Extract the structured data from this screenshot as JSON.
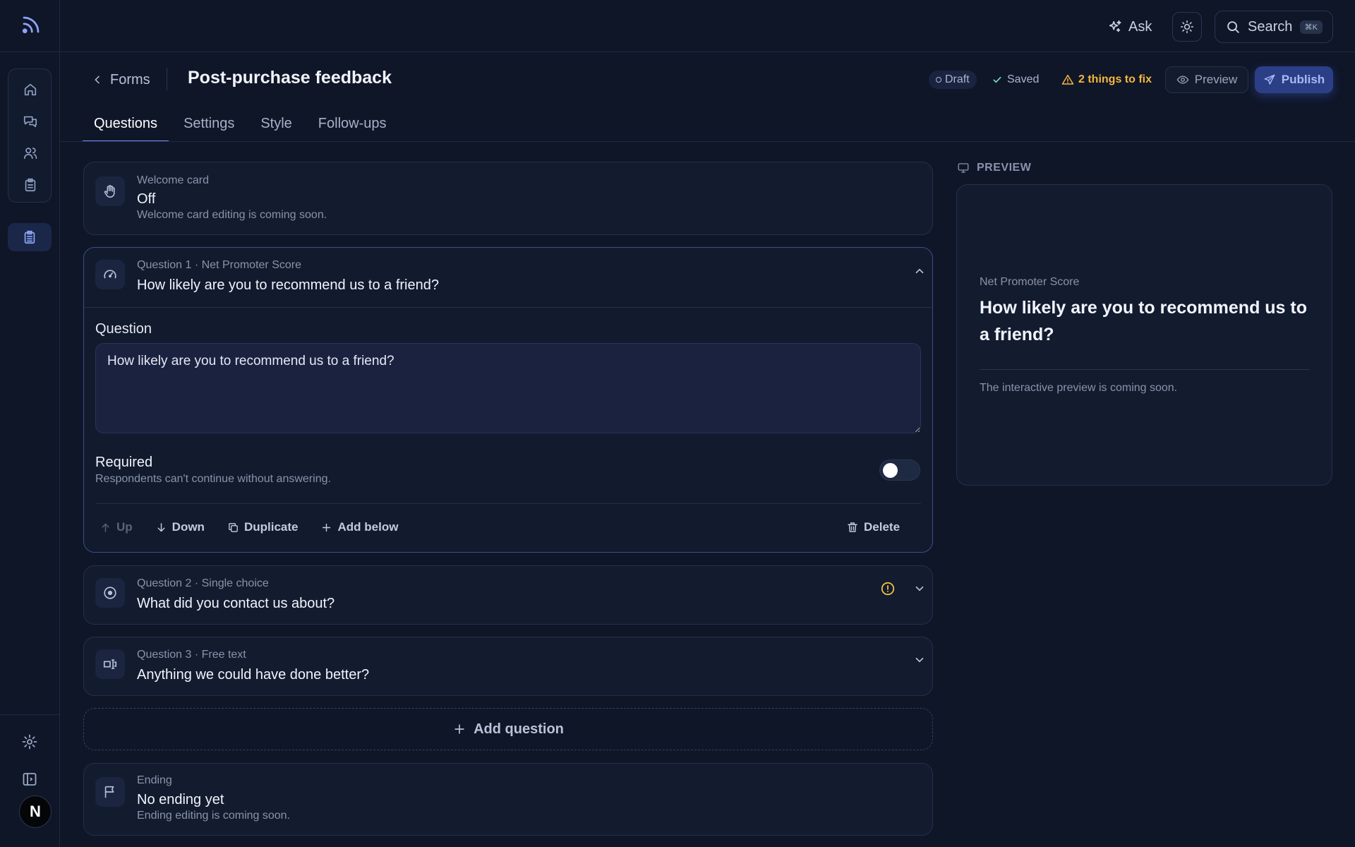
{
  "topbar": {
    "ask_label": "Ask",
    "search_label": "Search",
    "search_shortcut": "⌘K"
  },
  "sidebar": {
    "avatar_initial": "N"
  },
  "header": {
    "back_label": "Forms",
    "title": "Post-purchase feedback",
    "status_draft": "Draft",
    "status_saved": "Saved",
    "fix_label": "2 things to fix",
    "preview_label": "Preview",
    "publish_label": "Publish"
  },
  "tabs": [
    {
      "label": "Questions",
      "active": true
    },
    {
      "label": "Settings"
    },
    {
      "label": "Style"
    },
    {
      "label": "Follow-ups"
    }
  ],
  "welcome": {
    "kicker": "Welcome card",
    "title": "Off",
    "sub": "Welcome card editing is coming soon."
  },
  "questions": [
    {
      "kicker": "Question 1 · Net Promoter Score",
      "title": "How likely are you to recommend us to a friend?",
      "field_label": "Question",
      "text_value": "How likely are you to recommend us to a friend?",
      "required_label": "Required",
      "required_sub": "Respondents can't continue without answering.",
      "actions": {
        "up": "Up",
        "down": "Down",
        "duplicate": "Duplicate",
        "add_below": "Add below",
        "delete": "Delete"
      }
    },
    {
      "kicker": "Question 2 · Single choice",
      "title": "What did you contact us about?"
    },
    {
      "kicker": "Question 3 · Free text",
      "title": "Anything we could have done better?"
    }
  ],
  "add_question_label": "Add question",
  "ending": {
    "kicker": "Ending",
    "title": "No ending yet",
    "sub": "Ending editing is coming soon."
  },
  "preview": {
    "heading": "PREVIEW",
    "kicker": "Net Promoter Score",
    "title": "How likely are you to recommend us to a friend?",
    "note": "The interactive preview is coming soon."
  },
  "colors": {
    "background": "#0f1628",
    "accent": "#6f8cff",
    "warning": "#f5b73b",
    "success": "#6ee7b7"
  }
}
